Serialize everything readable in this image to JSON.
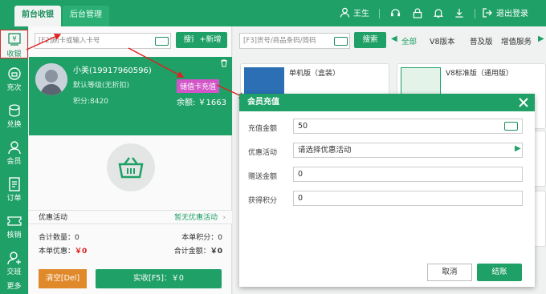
{
  "topbar": {
    "tabs": [
      "前台收银",
      "后台管理"
    ],
    "user": "王生",
    "logout": "退出登录"
  },
  "sidebar": [
    {
      "label": "收银",
      "icon": "yen-icon"
    },
    {
      "label": "充次",
      "icon": "timer-icon"
    },
    {
      "label": "兑换",
      "icon": "exchange-icon"
    },
    {
      "label": "会员",
      "icon": "user-icon"
    },
    {
      "label": "订单",
      "icon": "order-icon"
    },
    {
      "label": "核销",
      "icon": "ticket-icon"
    },
    {
      "label": "交班",
      "icon": "shift-icon"
    },
    {
      "label": "更多",
      "icon": "more-icon"
    }
  ],
  "left": {
    "search_placeholder": "[F2]刷卡或输入卡号",
    "search_btn": "搜索",
    "add_btn": "+新增",
    "member": {
      "name": "小美(19917960596)",
      "level": "默认等级(无折扣)",
      "points": "积分:8420",
      "recharge_tag": "储值卡充值",
      "balance": "余额: ￥1663"
    },
    "promo_label": "优惠活动",
    "promo_value": "暂无优惠活动",
    "total_qty": "合计数量：0",
    "bill_points": "本单积分：0",
    "bill_discount": "本单优惠：",
    "bill_discount_val": "￥0",
    "total_amount": "合计金额：",
    "total_amount_val": "￥0",
    "clear_btn": "清空[Del]",
    "pay_btn": "实收[F5]：￥0"
  },
  "right": {
    "search_placeholder": "[F3]货号/商品条码/简码",
    "search_btn": "搜索",
    "cats": [
      "全部",
      "V8版本",
      "普及版",
      "增值服务"
    ],
    "products": [
      "单机版（盒装）",
      "V8标准版（通用版）"
    ]
  },
  "modal": {
    "title": "会员充值",
    "fields": [
      {
        "label": "充值金额",
        "value": "50"
      },
      {
        "label": "优惠活动",
        "value": "请选择优惠活动"
      },
      {
        "label": "赠送金额",
        "value": "0"
      },
      {
        "label": "获得积分",
        "value": "0"
      }
    ],
    "cancel": "取消",
    "confirm": "结账"
  }
}
